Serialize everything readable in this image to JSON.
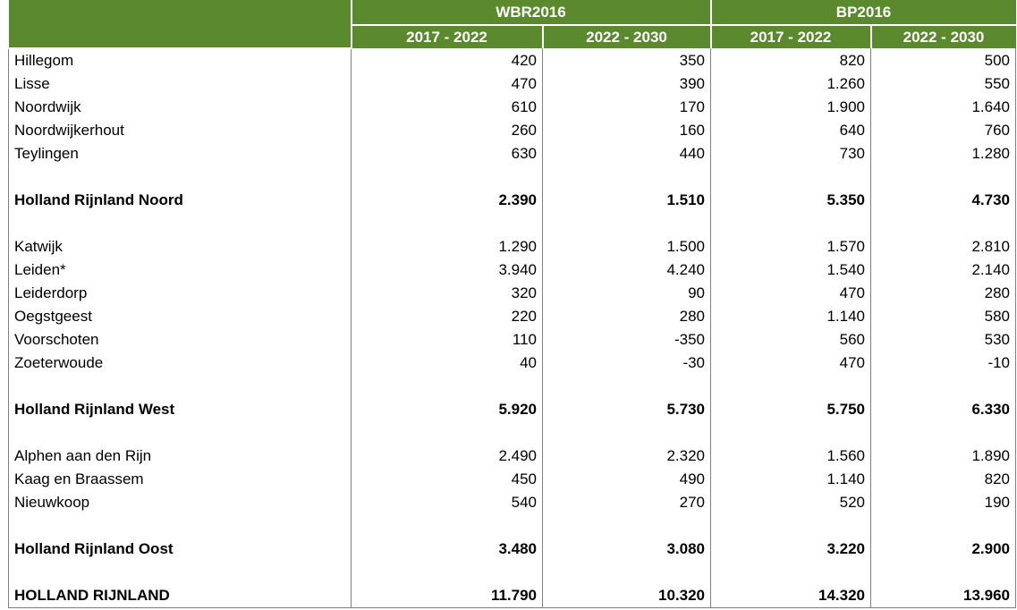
{
  "header": {
    "groups": [
      "WBR2016",
      "BP2016"
    ],
    "periods": [
      "2017 - 2022",
      "2022 - 2030",
      "2017 - 2022",
      "2022 - 2030"
    ]
  },
  "rows": [
    {
      "name": "Hillegom",
      "v": [
        "420",
        "350",
        "820",
        "500"
      ],
      "bold": false
    },
    {
      "name": "Lisse",
      "v": [
        "470",
        "390",
        "1.260",
        "550"
      ],
      "bold": false
    },
    {
      "name": "Noordwijk",
      "v": [
        "610",
        "170",
        "1.900",
        "1.640"
      ],
      "bold": false
    },
    {
      "name": "Noordwijkerhout",
      "v": [
        "260",
        "160",
        "640",
        "760"
      ],
      "bold": false
    },
    {
      "name": "Teylingen",
      "v": [
        "630",
        "440",
        "730",
        "1.280"
      ],
      "bold": false
    },
    {
      "blank": true
    },
    {
      "name": "Holland Rijnland Noord",
      "v": [
        "2.390",
        "1.510",
        "5.350",
        "4.730"
      ],
      "bold": true
    },
    {
      "blank": true
    },
    {
      "name": "Katwijk",
      "v": [
        "1.290",
        "1.500",
        "1.570",
        "2.810"
      ],
      "bold": false
    },
    {
      "name": "Leiden*",
      "v": [
        "3.940",
        "4.240",
        "1.540",
        "2.140"
      ],
      "bold": false
    },
    {
      "name": "Leiderdorp",
      "v": [
        "320",
        "90",
        "470",
        "280"
      ],
      "bold": false
    },
    {
      "name": "Oegstgeest",
      "v": [
        "220",
        "280",
        "1.140",
        "580"
      ],
      "bold": false
    },
    {
      "name": "Voorschoten",
      "v": [
        "110",
        "-350",
        "560",
        "530"
      ],
      "bold": false
    },
    {
      "name": "Zoeterwoude",
      "v": [
        "40",
        "-30",
        "470",
        "-10"
      ],
      "bold": false
    },
    {
      "blank": true
    },
    {
      "name": "Holland Rijnland West",
      "v": [
        "5.920",
        "5.730",
        "5.750",
        "6.330"
      ],
      "bold": true
    },
    {
      "blank": true
    },
    {
      "name": "Alphen aan den Rijn",
      "v": [
        "2.490",
        "2.320",
        "1.560",
        "1.890"
      ],
      "bold": false
    },
    {
      "name": "Kaag en Braassem",
      "v": [
        "450",
        "490",
        "1.140",
        "820"
      ],
      "bold": false
    },
    {
      "name": "Nieuwkoop",
      "v": [
        "540",
        "270",
        "520",
        "190"
      ],
      "bold": false
    },
    {
      "blank": true
    },
    {
      "name": "Holland Rijnland Oost",
      "v": [
        "3.480",
        "3.080",
        "3.220",
        "2.900"
      ],
      "bold": true
    },
    {
      "blank": true
    },
    {
      "name": "HOLLAND RIJNLAND",
      "v": [
        "11.790",
        "10.320",
        "14.320",
        "13.960"
      ],
      "bold": true
    }
  ]
}
